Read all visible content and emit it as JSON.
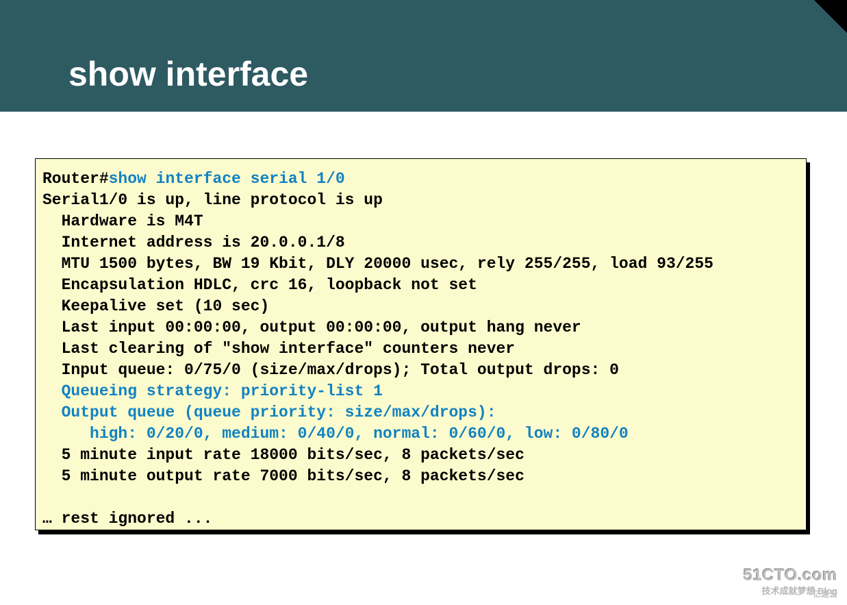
{
  "slide": {
    "title": "show interface"
  },
  "terminal": {
    "prompt": "Router#",
    "command": "show interface serial 1/0",
    "lines": {
      "l0": "Serial1/0 is up, line protocol is up",
      "l1": "  Hardware is M4T",
      "l2": "  Internet address is 20.0.0.1/8",
      "l3": "  MTU 1500 bytes, BW 19 Kbit, DLY 20000 usec, rely 255/255, load 93/255",
      "l4": "  Encapsulation HDLC, crc 16, loopback not set",
      "l5": "  Keepalive set (10 sec)",
      "l6": "  Last input 00:00:00, output 00:00:00, output hang never",
      "l7": "  Last clearing of \"show interface\" counters never",
      "l8": "  Input queue: 0/75/0 (size/max/drops); Total output drops: 0",
      "h0": "  Queueing strategy: priority-list 1",
      "h1": "  Output queue (queue priority: size/max/drops):",
      "h2": "     high: 0/20/0, medium: 0/40/0, normal: 0/60/0, low: 0/80/0",
      "l9": "  5 minute input rate 18000 bits/sec, 8 packets/sec",
      "l10": "  5 minute output rate 7000 bits/sec, 8 packets/sec",
      "rest": "… rest ignored ..."
    }
  },
  "watermark": {
    "line1": "51CTO.com",
    "line2": "技术成就梦想  Blog",
    "yisu": "亿速云"
  }
}
